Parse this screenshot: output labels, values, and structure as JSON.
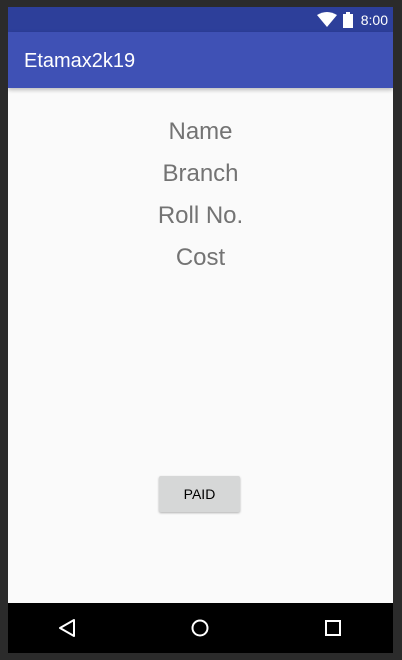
{
  "status_bar": {
    "time": "8:00",
    "icons": [
      "wifi-icon",
      "battery-icon"
    ]
  },
  "app_bar": {
    "title": "Etamax2k19"
  },
  "content": {
    "name_label": "Name",
    "branch_label": "Branch",
    "roll_no_label": "Roll No.",
    "cost_label": "Cost",
    "paid_button": "PAID"
  },
  "nav_bar": {
    "icons": [
      "back-icon",
      "home-icon",
      "recents-icon"
    ]
  },
  "colors": {
    "status_bar": "#2d3f9a",
    "app_bar": "#3f51b5",
    "background": "#fafafa",
    "text_gray": "#737373",
    "button": "#d6d7d7"
  }
}
